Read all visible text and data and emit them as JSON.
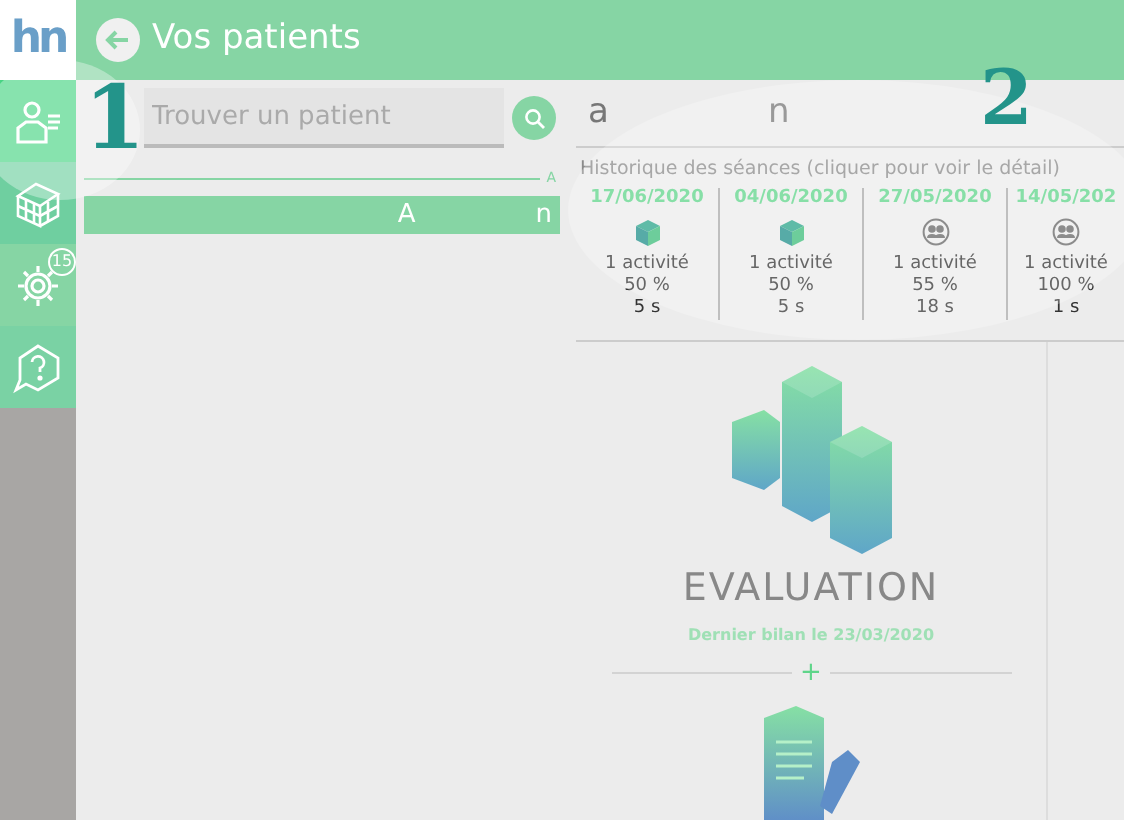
{
  "logo": {
    "text": "hn"
  },
  "header": {
    "title": "Vos patients"
  },
  "sidebar": {
    "items": [
      {
        "kind": "patients",
        "selected": true
      },
      {
        "kind": "activities",
        "selected": false
      },
      {
        "kind": "settings",
        "selected": false,
        "badge": "15"
      },
      {
        "kind": "help",
        "selected": false
      }
    ]
  },
  "search": {
    "placeholder": "Trouver un patient"
  },
  "patient_list": {
    "index_letter": "A",
    "rows": [
      {
        "column_1": "A",
        "column_2": "n",
        "selected": true
      }
    ]
  },
  "patient": {
    "first_name": "a",
    "last_name": "n"
  },
  "history": {
    "title": "Historique des séances (cliquer pour voir le détail)",
    "sessions": [
      {
        "date": "17/06/2020",
        "kind": "solo",
        "activities": "1 activité",
        "score": "50 %",
        "duration": "5 s"
      },
      {
        "date": "04/06/2020",
        "kind": "solo",
        "activities": "1 activité",
        "score": "50 %",
        "duration": "5 s"
      },
      {
        "date": "27/05/2020",
        "kind": "group",
        "activities": "1 activité",
        "score": "55 %",
        "duration": "18 s"
      },
      {
        "date": "14/05/202",
        "kind": "group",
        "activities": "1 activité",
        "score": "100 %",
        "duration": "1 s"
      }
    ]
  },
  "modules": [
    {
      "kind": "evaluation",
      "title": "EVALUATION",
      "subtitle": "Dernier bilan le 23/03/2020",
      "action": "+"
    },
    {
      "kind": "report"
    }
  ],
  "annotations": [
    {
      "number": "1"
    },
    {
      "number": "2"
    }
  ]
}
